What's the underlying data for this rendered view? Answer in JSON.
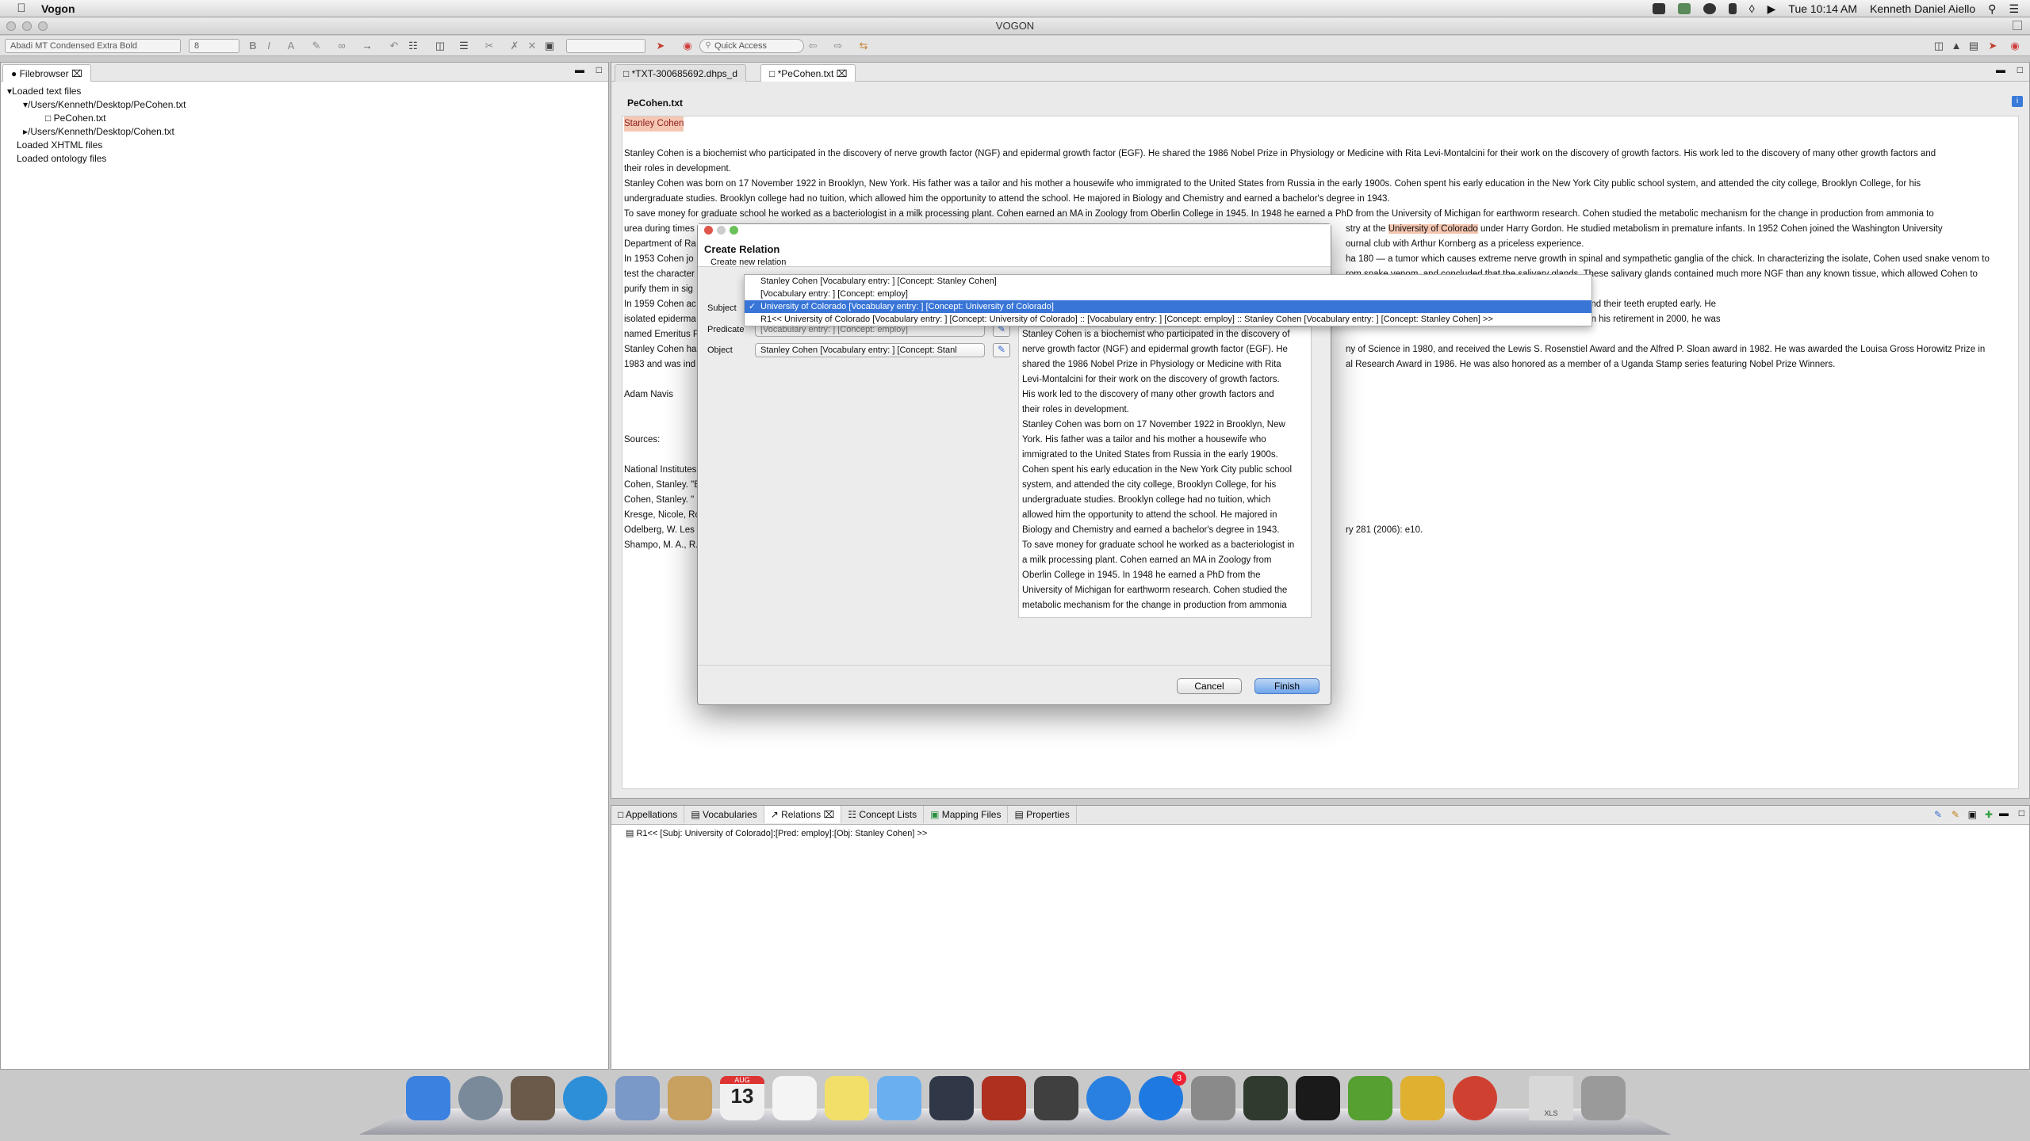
{
  "menubar": {
    "app_name": "Vogon",
    "clock": "Tue 10:14 AM",
    "user": "Kenneth Daniel Aiello"
  },
  "window": {
    "title": "VOGON"
  },
  "toolbar": {
    "font_name": "Abadi MT Condensed Extra Bold",
    "font_size": "8",
    "quick_access_placeholder": "Quick Access"
  },
  "filebrowser": {
    "tab_label": "Filebrowser",
    "items": [
      "Loaded text files",
      "/Users/Kenneth/Desktop/PeCohen.txt",
      "PeCohen.txt",
      "/Users/Kenneth/Desktop/Cohen.txt",
      "Loaded XHTML files",
      "Loaded ontology files"
    ]
  },
  "editor": {
    "tabs": [
      "*TXT-300685692.dhps_d",
      "*PeCohen.txt"
    ],
    "doc_title": "PeCohen.txt",
    "lines": [
      "Stanley Cohen",
      "",
      "Stanley Cohen is a biochemist who participated in the discovery of nerve growth factor (NGF) and epidermal growth factor (EGF).  He shared the 1986 Nobel Prize in Physiology or Medicine with Rita Levi-Montalcini for their work on the discovery of growth factors.  His work led to the discovery of many other growth factors and",
      "their roles in development.",
      "Stanley Cohen was born on 17 November 1922 in Brooklyn, New York.  His father was a tailor and his mother a housewife who immigrated to the United States from Russia in the early 1900s.  Cohen spent his early education in the New York City public school system, and attended the city college, Brooklyn College, for his",
      "undergraduate studies.  Brooklyn college had no tuition, which allowed him the opportunity to attend the school.   He majored in Biology and Chemistry and earned a bachelor's degree in 1943.",
      "To save money for graduate school he worked as a bacteriologist in a milk processing plant.  Cohen earned an MA in Zoology from Oberlin College in 1945.  In 1948 he earned a PhD from the University of Michigan for earthworm research.  Cohen studied the metabolic mechanism for the change in production from ammonia to",
      "urea during times",
      "Department of Ra",
      "In 1953 Cohen jo",
      "test the character",
      "purify them in sig",
      "In 1959 Cohen ac",
      "isolated epiderma",
      "named Emeritus P",
      "Stanley Cohen has",
      "1983 and was ind",
      "",
      "Adam Navis",
      "",
      "",
      "Sources:",
      "",
      "National Institutes",
      "Cohen, Stanley. \"E",
      "Cohen, Stanley. \"",
      "Kresge, Nicole, Ro",
      "Odelberg, W.  Les",
      "Shampo, M. A., R."
    ],
    "right_lines": [
      {
        "row": 7,
        "text": "stry at the ",
        "hl": "University of Colorado",
        "after": " under Harry Gordon.  He studied metabolism in premature infants.  In 1952 Cohen joined the Washington University"
      },
      {
        "row": 8,
        "text": "ournal club with Arthur Kornberg as a priceless experience."
      },
      {
        "row": 9,
        "text": "ha 180 — a tumor which causes extreme nerve growth in spinal and sympathetic ganglia of the chick.  In characterizing the isolate, Cohen used snake venom to"
      },
      {
        "row": 10,
        "text": "rom snake venom, and concluded that the salivary glands.  These salivary glands contained much more NGF than any known tissue, which allowed Cohen to"
      },
      {
        "row": 12,
        "text": "cted mice with mouse salivary extract, their eyelids opened and their teeth erupted early.  He"
      },
      {
        "row": 13,
        "text": "Distinguished Professor in 1986 at Vanderbilt University.  Upon his retirement in 2000, he was"
      },
      {
        "row": 15,
        "text": "ny of Science in 1980, and received the Lewis S. Rosenstiel Award and the Alfred P. Sloan award in 1982.  He was awarded the Louisa Gross Horowitz Prize in"
      },
      {
        "row": 16,
        "text": "al Research Award in 1986.  He was also honored as a member of a Uganda Stamp series featuring Nobel Prize Winners."
      },
      {
        "row": 27,
        "text": "ry 281 (2006): e10."
      }
    ]
  },
  "bottom": {
    "tabs": [
      "Appellations",
      "Vocabularies",
      "Relations",
      "Concept Lists",
      "Mapping Files",
      "Properties"
    ],
    "relation_row": "R1<< [Subj: University of Colorado]:[Pred: employ]:[Obj: Stanley Cohen] >>"
  },
  "dialog": {
    "title": "Create Relation",
    "subtitle": "Create new relation",
    "subject_label": "Subject",
    "predicate_label": "Predicate",
    "object_label": "Object",
    "predicate_value": "[Vocabulary entry: ]  [Concept: employ]",
    "object_value": "Stanley Cohen [Vocabulary entry: ]  [Concept: Stanl",
    "cancel": "Cancel",
    "finish": "Finish",
    "dropdown": [
      "Stanley Cohen [Vocabulary entry: ]  [Concept: Stanley Cohen]",
      "[Vocabulary entry: ]  [Concept: employ]",
      "University of Colorado [Vocabulary entry: ]  [Concept: University of Colorado]",
      "R1<< University of Colorado [Vocabulary entry: ]  [Concept: University of Colorado] ::  [Vocabulary entry: ]  [Concept: employ] :: Stanley Cohen [Vocabulary entry: ]  [Concept: Stanley Cohen] >>"
    ],
    "excerpt": [
      "Stanley Cohen is a biochemist who participated in the discovery of",
      "nerve growth factor (NGF) and epidermal growth factor (EGF).  He",
      "shared the 1986 Nobel Prize in Physiology or Medicine with Rita",
      "Levi-Montalcini for their work on the discovery of growth factors.",
      "His work led to the discovery of many other growth factors and",
      "their roles in development.",
      "Stanley Cohen was born on 17 November 1922 in Brooklyn, New",
      "York.  His father was a tailor and his mother a housewife who",
      "immigrated to the United States from Russia in the early 1900s.",
      "Cohen spent his early education in the New York City public school",
      "system, and attended the city college, Brooklyn College, for his",
      "undergraduate studies.  Brooklyn college had no tuition, which",
      "allowed him the opportunity to attend the school.   He majored in",
      "Biology and Chemistry and earned a bachelor's degree in 1943.",
      "To save money for graduate school he worked as a bacteriologist in",
      "a milk processing plant.  Cohen earned an MA in Zoology from",
      "Oberlin College in 1945.  In 1948 he earned a PhD from the",
      "University of Michigan for earthworm research.  Cohen studied the",
      "metabolic mechanism for the change in production from ammonia"
    ]
  },
  "dock": {
    "calendar_month": "AUG",
    "calendar_day": "13",
    "appstore_badge": "3",
    "xls_label": "XLS",
    "colors": [
      "#3b82e0",
      "#7a8a9a",
      "#6b5a4a",
      "#2d8fd8",
      "#7a98c8",
      "#c8a060",
      "#f0f0f0",
      "#f4f4f4",
      "#f2df6a",
      "#6ab0f0",
      "#303848",
      "#b03020",
      "#404040",
      "#2a80e0",
      "#1e7ae0",
      "#8a8a8a",
      "#2e3b2e",
      "#1a1a1a",
      "#55a030",
      "#e0b030",
      "#d04030",
      "#d8d8d8",
      "#9a9a9a"
    ]
  }
}
